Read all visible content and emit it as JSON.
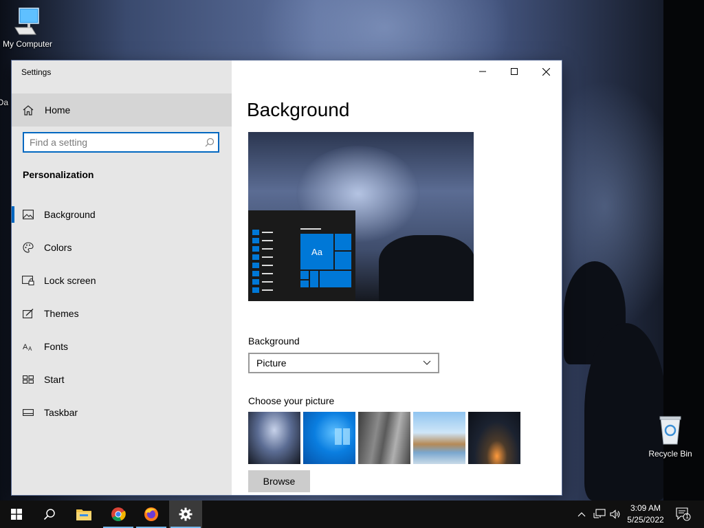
{
  "desktop": {
    "icons": [
      {
        "label": "My Computer"
      },
      {
        "label": "Recycle Bin"
      }
    ],
    "partial_icon_label": "Da"
  },
  "window": {
    "title": "Settings",
    "nav": {
      "home": "Home",
      "search_placeholder": "Find a setting",
      "section": "Personalization",
      "items": [
        {
          "label": "Background",
          "icon": "image-icon"
        },
        {
          "label": "Colors",
          "icon": "palette-icon"
        },
        {
          "label": "Lock screen",
          "icon": "lock-screen-icon"
        },
        {
          "label": "Themes",
          "icon": "themes-icon"
        },
        {
          "label": "Fonts",
          "icon": "fonts-icon"
        },
        {
          "label": "Start",
          "icon": "start-icon"
        },
        {
          "label": "Taskbar",
          "icon": "taskbar-icon"
        }
      ],
      "active": "Background"
    },
    "content": {
      "title": "Background",
      "preview_tile_text": "Aa",
      "background_label": "Background",
      "background_value": "Picture",
      "choose_label": "Choose your picture",
      "browse": "Browse"
    }
  },
  "taskbar": {
    "time": "3:09 AM",
    "date": "5/25/2022",
    "notification_count": "1"
  },
  "colors": {
    "accent": "#0067c0",
    "tile_blue": "#0078d7",
    "taskbar": "#101010"
  }
}
